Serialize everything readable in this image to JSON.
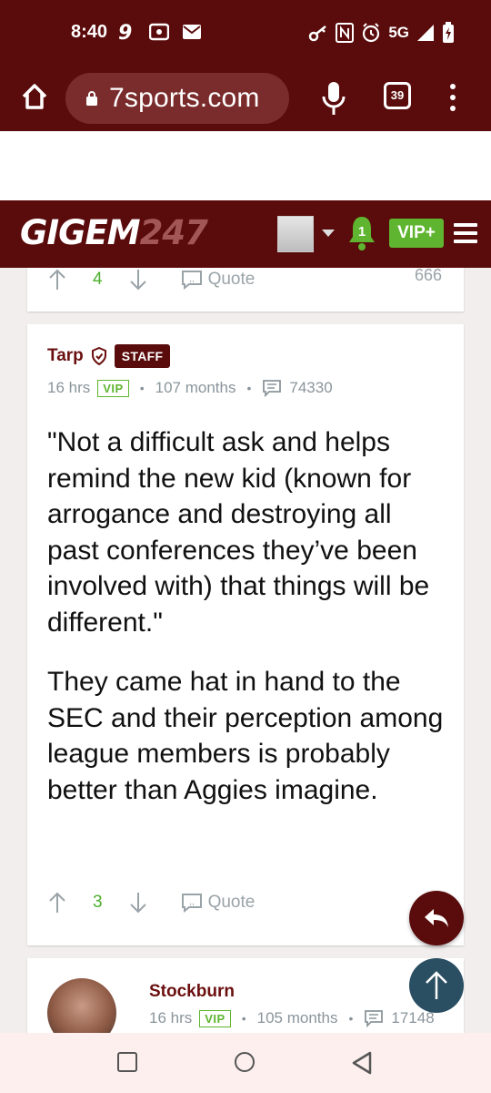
{
  "status_bar": {
    "time": "8:40",
    "network": "5G"
  },
  "browser": {
    "url": "7sports.com",
    "tab_count": "39"
  },
  "site_header": {
    "logo_text": "GIGEM",
    "logo_number": "247",
    "notification_count": "1",
    "vip_label": "VIP+"
  },
  "prev_post": {
    "upvotes": "4",
    "quote_label": "Quote",
    "partial_right": "666"
  },
  "post": {
    "author": "Tarp",
    "badge": "STAFF",
    "time_ago": "16 hrs",
    "vip_tag": "VIP",
    "tenure": "107 months",
    "post_count": "74330",
    "paragraphs": [
      "\"Not a difficult ask and helps remind the new kid (known for arrogance and destroying all past conferences they’ve been involved with) that things will be different.\"",
      "They came hat in hand to the SEC and their perception among league members is probably better than Aggies imagine."
    ],
    "upvotes": "3",
    "quote_label": "Quote"
  },
  "next_post": {
    "author": "Stockburn",
    "time_ago": "16 hrs",
    "vip_tag": "VIP",
    "tenure": "105 months",
    "post_count": "17148"
  },
  "colors": {
    "brand_maroon": "#5a0b0b",
    "vip_green": "#5fb52f",
    "scroll_top_blue": "#2a4e62"
  }
}
